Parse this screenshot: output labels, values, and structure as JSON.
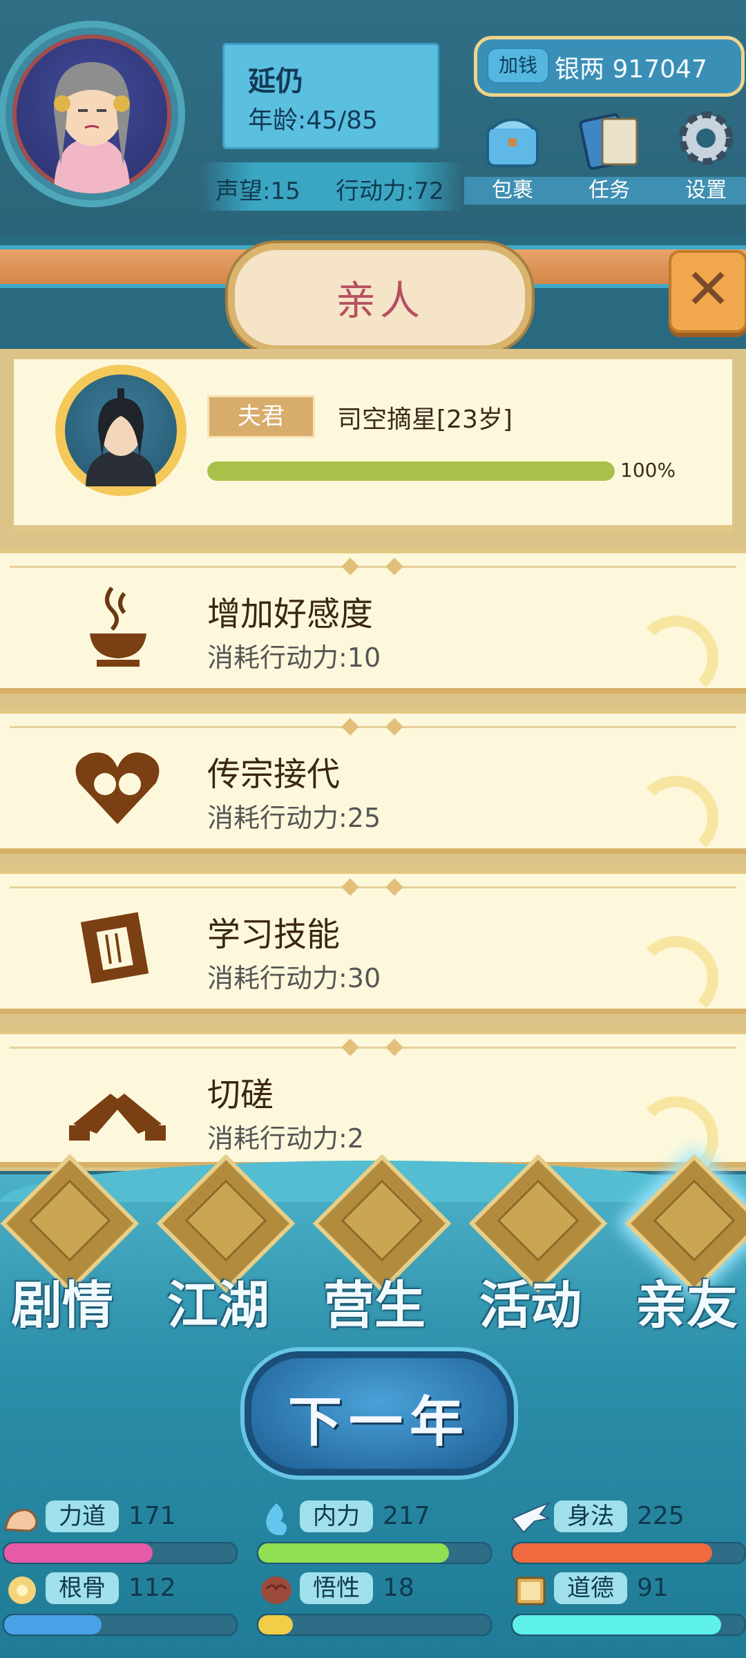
{
  "header": {
    "name": "延仍",
    "age": "年龄:45/85",
    "reputation": "声望:15",
    "action_points": "行动力:72",
    "add_money_label": "加钱",
    "silver": "银两 917047",
    "toolbar": [
      {
        "label": "包裹",
        "icon": "bag-icon"
      },
      {
        "label": "任务",
        "icon": "quest-book-icon"
      },
      {
        "label": "设置",
        "icon": "gear-icon"
      }
    ]
  },
  "panel": {
    "title": "亲人",
    "close_icon": "close-icon"
  },
  "spouse": {
    "relation": "夫君",
    "name": "司空摘星[23岁]",
    "affection_percent": 100,
    "affection_label": "100%"
  },
  "actions": [
    {
      "title": "增加好感度",
      "cost": "消耗行动力:10",
      "icon": "tea-bowl-icon"
    },
    {
      "title": "传宗接代",
      "cost": "消耗行动力:25",
      "icon": "heart-couple-icon"
    },
    {
      "title": "学习技能",
      "cost": "消耗行动力:30",
      "icon": "scroll-icon"
    },
    {
      "title": "切磋",
      "cost": "消耗行动力:2",
      "icon": "handshake-icon"
    }
  ],
  "nav": [
    {
      "label": "剧情",
      "icon": "story-icon"
    },
    {
      "label": "江湖",
      "icon": "jianghu-icon"
    },
    {
      "label": "营生",
      "icon": "abacus-icon"
    },
    {
      "label": "活动",
      "icon": "activity-icon"
    },
    {
      "label": "亲友",
      "icon": "family-icon"
    }
  ],
  "next_year_label": "下一年",
  "attributes": [
    {
      "name": "力道",
      "value": "171",
      "fraction": 0.64,
      "color": "#e65aa8",
      "icon": "arm-icon"
    },
    {
      "name": "内力",
      "value": "217",
      "fraction": 0.82,
      "color": "#8fe052",
      "icon": "energy-icon"
    },
    {
      "name": "身法",
      "value": "225",
      "fraction": 0.86,
      "color": "#ef6a3f",
      "icon": "swallow-icon"
    },
    {
      "name": "根骨",
      "value": "112",
      "fraction": 0.42,
      "color": "#4aa2e6",
      "icon": "bone-icon"
    },
    {
      "name": "悟性",
      "value": "18",
      "fraction": 0.15,
      "color": "#f2cd47",
      "icon": "brain-icon"
    },
    {
      "name": "道德",
      "value": "91",
      "fraction": 0.9,
      "color": "#5ef0ea",
      "icon": "book-icon"
    }
  ]
}
